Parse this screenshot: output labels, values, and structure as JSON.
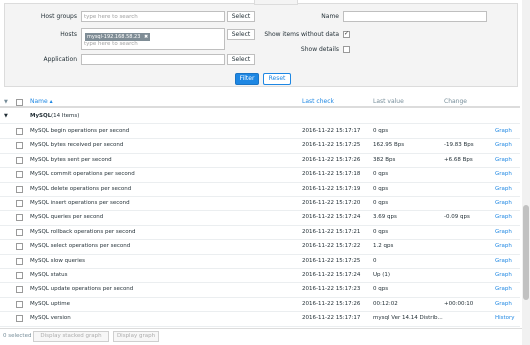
{
  "filter": {
    "host_groups_label": "Host groups",
    "host_groups_placeholder": "type here to search",
    "hosts_label": "Hosts",
    "hosts_tag": "mysql-192.168.58.23",
    "hosts_placeholder": "type here to search",
    "application_label": "Application",
    "select_label": "Select",
    "name_label": "Name",
    "show_without_data_label": "Show items without data",
    "show_details_label": "Show details",
    "filter_button": "Filter",
    "reset_button": "Reset"
  },
  "table": {
    "headers": {
      "name": "Name ▴",
      "last_check": "Last check",
      "last_value": "Last value",
      "change": "Change"
    },
    "group": {
      "name": "MySQL",
      "count": "(14 Items)"
    },
    "rows": [
      {
        "name": "MySQL begin operations per second",
        "last_check": "2016-11-22 15:17:17",
        "last_value": "0 qps",
        "change": "",
        "action": "Graph"
      },
      {
        "name": "MySQL bytes received per second",
        "last_check": "2016-11-22 15:17:25",
        "last_value": "162.95 Bps",
        "change": "-19.83 Bps",
        "action": "Graph"
      },
      {
        "name": "MySQL bytes sent per second",
        "last_check": "2016-11-22 15:17:26",
        "last_value": "382 Bps",
        "change": "+6.68 Bps",
        "action": "Graph"
      },
      {
        "name": "MySQL commit operations per second",
        "last_check": "2016-11-22 15:17:18",
        "last_value": "0 qps",
        "change": "",
        "action": "Graph"
      },
      {
        "name": "MySQL delete operations per second",
        "last_check": "2016-11-22 15:17:19",
        "last_value": "0 qps",
        "change": "",
        "action": "Graph"
      },
      {
        "name": "MySQL insert operations per second",
        "last_check": "2016-11-22 15:17:20",
        "last_value": "0 qps",
        "change": "",
        "action": "Graph"
      },
      {
        "name": "MySQL queries per second",
        "last_check": "2016-11-22 15:17:24",
        "last_value": "3.69 qps",
        "change": "-0.09 qps",
        "action": "Graph"
      },
      {
        "name": "MySQL rollback operations per second",
        "last_check": "2016-11-22 15:17:21",
        "last_value": "0 qps",
        "change": "",
        "action": "Graph"
      },
      {
        "name": "MySQL select operations per second",
        "last_check": "2016-11-22 15:17:22",
        "last_value": "1.2 qps",
        "change": "",
        "action": "Graph"
      },
      {
        "name": "MySQL slow queries",
        "last_check": "2016-11-22 15:17:25",
        "last_value": "0",
        "change": "",
        "action": "Graph"
      },
      {
        "name": "MySQL status",
        "last_check": "2016-11-22 15:17:24",
        "last_value": "Up (1)",
        "change": "",
        "action": "Graph"
      },
      {
        "name": "MySQL update operations per second",
        "last_check": "2016-11-22 15:17:23",
        "last_value": "0 qps",
        "change": "",
        "action": "Graph"
      },
      {
        "name": "MySQL uptime",
        "last_check": "2016-11-22 15:17:26",
        "last_value": "00:12:02",
        "change": "+00:00:10",
        "action": "Graph"
      },
      {
        "name": "MySQL version",
        "last_check": "2016-11-22 15:17:17",
        "last_value": "mysql Ver 14.14 Distrib...",
        "change": "",
        "action": "History"
      }
    ]
  },
  "footer": {
    "selected": "0 selected",
    "stacked_graph": "Display stacked graph",
    "graph": "Display graph"
  }
}
